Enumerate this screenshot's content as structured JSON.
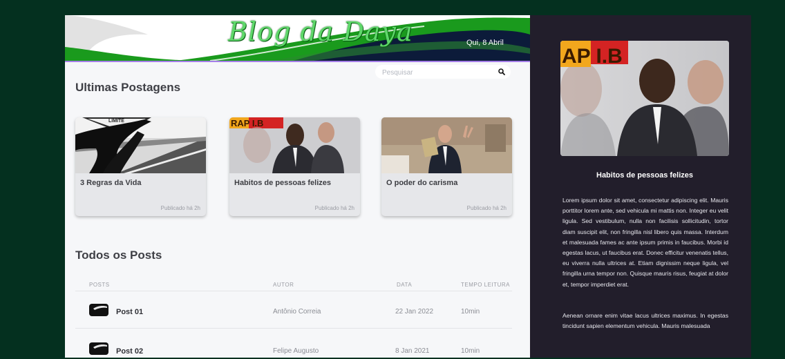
{
  "header": {
    "logo_text": "Blog da Daya",
    "date": "Qui, 8 Abril"
  },
  "search": {
    "placeholder": "Pesquisar",
    "value": ""
  },
  "latest": {
    "title": "Ultimas Postagens",
    "cards": [
      {
        "title": "3 Regras da Vida",
        "meta": "Publicado há 2h",
        "image_badge": "LIMITE"
      },
      {
        "title": "Habitos de pessoas felizes",
        "meta": "Publicado há 2h",
        "image_badge": "RAP I.B"
      },
      {
        "title": "O poder do carisma",
        "meta": "Publicado há 2h"
      }
    ]
  },
  "all_posts": {
    "title": "Todos os Posts",
    "columns": [
      "POSTS",
      "AUTOR",
      "DATA",
      "TEMPO LEITURA"
    ],
    "rows": [
      {
        "name": "Post 01",
        "author": "Antônio Correia",
        "date": "22 Jan 2022",
        "time": "10min"
      },
      {
        "name": "Post 02",
        "author": "Felipe Augusto",
        "date": "8 Jan 2021",
        "time": "10min"
      }
    ]
  },
  "sidebar": {
    "image_badge": "AP I.B",
    "title": "Habitos de pessoas felizes",
    "paragraphs": [
      "Lorem ipsum dolor sit amet, consectetur adipiscing elit. Mauris porttitor lorem ante, sed vehicula mi mattis non. Integer eu velit ligula. Sed vestibulum, nulla non facilisis sollicitudin, tortor diam suscipit elit, non fringilla nisl libero quis massa. Interdum et malesuada fames ac ante ipsum primis in faucibus. Morbi id egestas lacus, ut faucibus erat. Donec efficitur venenatis tellus, eu viverra nulla ultrices at. Etiam dignissim neque ligula, vel fringilla urna tempor non. Quisque mauris risus, feugiat at dolor et, tempor imperdiet erat.",
      "Aenean ornare enim vitae lacus ultrices maximus. In egestas tincidunt sapien elementum vehicula. Mauris malesuada"
    ]
  },
  "colors": {
    "page_bg": "#04301f",
    "header_green": "#1a9a1d",
    "header_navy": "#0c1b3a",
    "accent_purple": "#a57ee8",
    "sidebar_bg": "#221e2b",
    "logo_green": "#5fd86a"
  },
  "icons": {
    "search": "search-icon",
    "post": "post-thumbnail-icon"
  }
}
